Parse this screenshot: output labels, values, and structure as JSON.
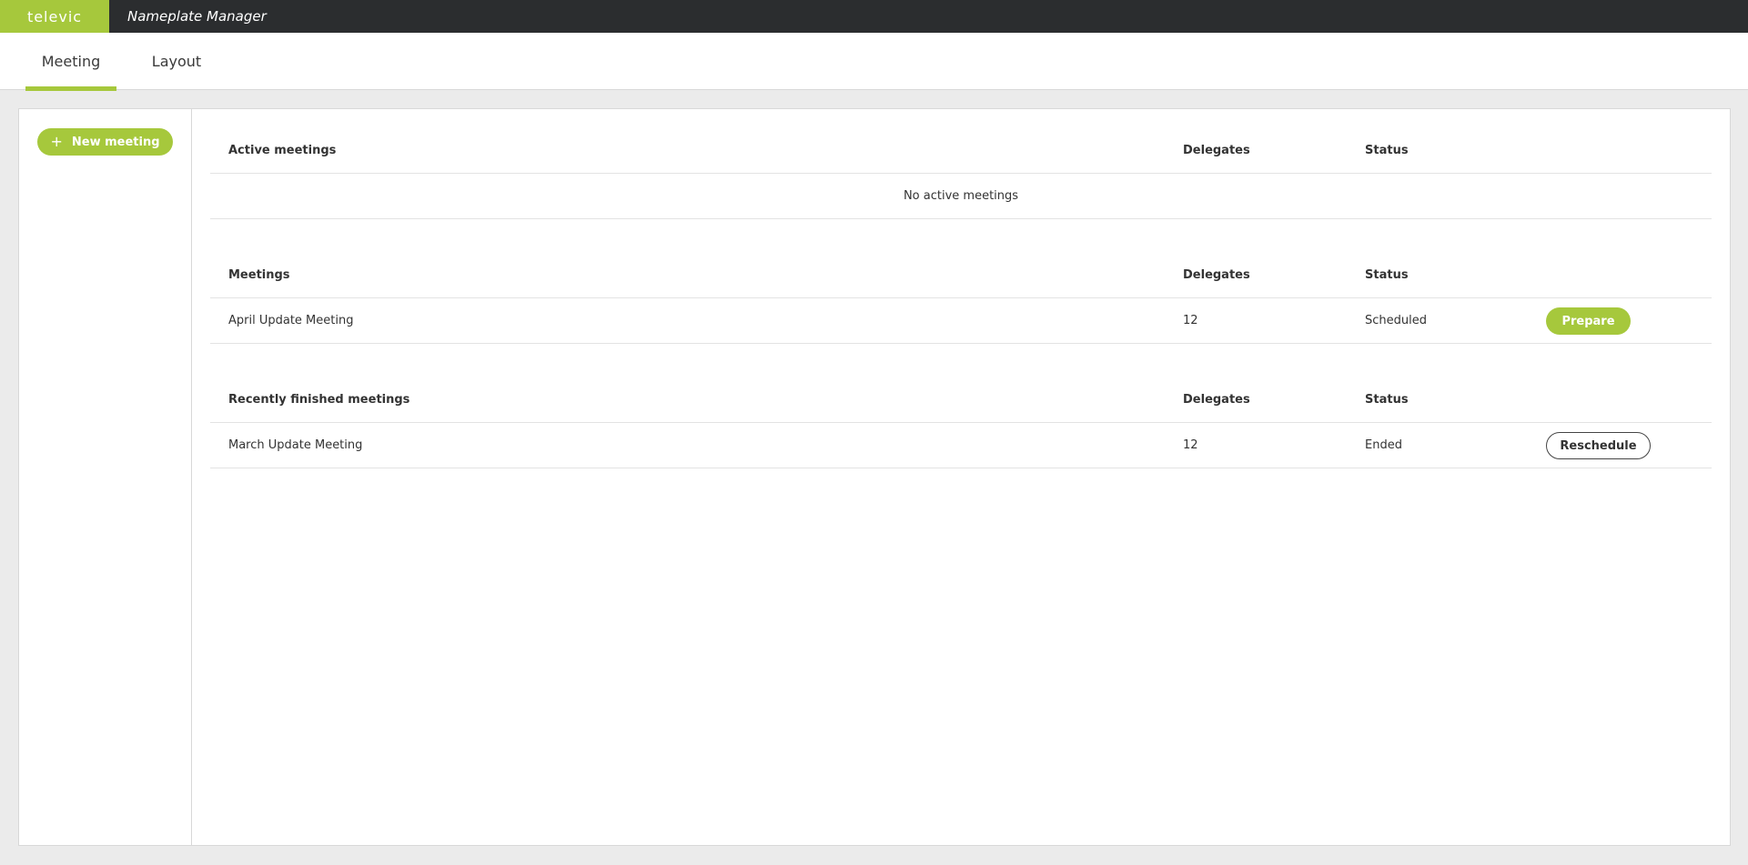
{
  "header": {
    "brand": "televic",
    "app_title": "Nameplate Manager"
  },
  "tabs": [
    {
      "label": "Meeting",
      "active": true
    },
    {
      "label": "Layout",
      "active": false
    }
  ],
  "sidebar": {
    "new_meeting_icon": "+",
    "new_meeting_label": "New meeting"
  },
  "active_meetings": {
    "header": {
      "name": "Active meetings",
      "delegates": "Delegates",
      "status": "Status"
    },
    "empty_text": "No active meetings"
  },
  "meetings": {
    "header": {
      "name": "Meetings",
      "delegates": "Delegates",
      "status": "Status"
    },
    "rows": [
      {
        "name": "April Update Meeting",
        "delegates": "12",
        "status": "Scheduled",
        "action": "Prepare"
      }
    ]
  },
  "finished_meetings": {
    "header": {
      "name": "Recently finished meetings",
      "delegates": "Delegates",
      "status": "Status"
    },
    "rows": [
      {
        "name": "March Update Meeting",
        "delegates": "12",
        "status": "Ended",
        "action": "Reschedule"
      }
    ]
  },
  "colors": {
    "accent": "#a6c83c",
    "topbar": "#2b2d2f"
  }
}
